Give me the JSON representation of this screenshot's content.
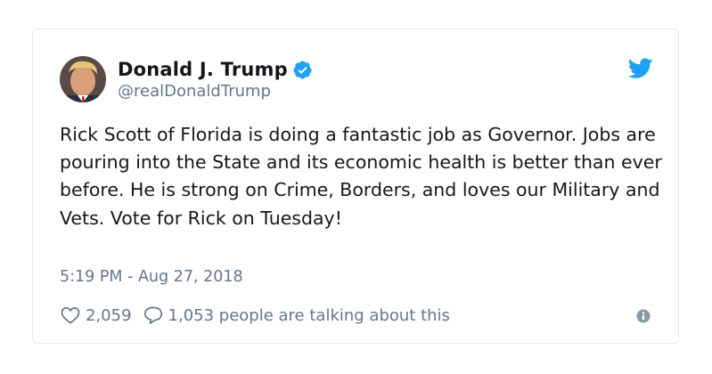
{
  "author": {
    "display_name": "Donald J. Trump",
    "handle": "@realDonaldTrump",
    "verified": true,
    "verified_icon": "verified-badge-icon",
    "avatar_icon": "profile-avatar"
  },
  "tweet": {
    "text": "Rick Scott of Florida is doing a fantastic job as Governor. Jobs are pouring into the State and its economic health is better than ever before. He is strong on Crime, Borders, and loves our Military and Vets. Vote for Rick on Tuesday!",
    "timestamp": "5:19 PM - Aug 27, 2018"
  },
  "actions": {
    "like_count": "2,059",
    "reply_text": "1,053 people are talking about this"
  },
  "icons": {
    "brand": "twitter-bird-icon",
    "like": "heart-icon",
    "reply": "speech-bubble-icon",
    "info": "info-icon"
  },
  "colors": {
    "brand_blue": "#1da1f2",
    "text_primary": "#14171a",
    "text_secondary": "#657786",
    "border": "#e1e8ed"
  }
}
